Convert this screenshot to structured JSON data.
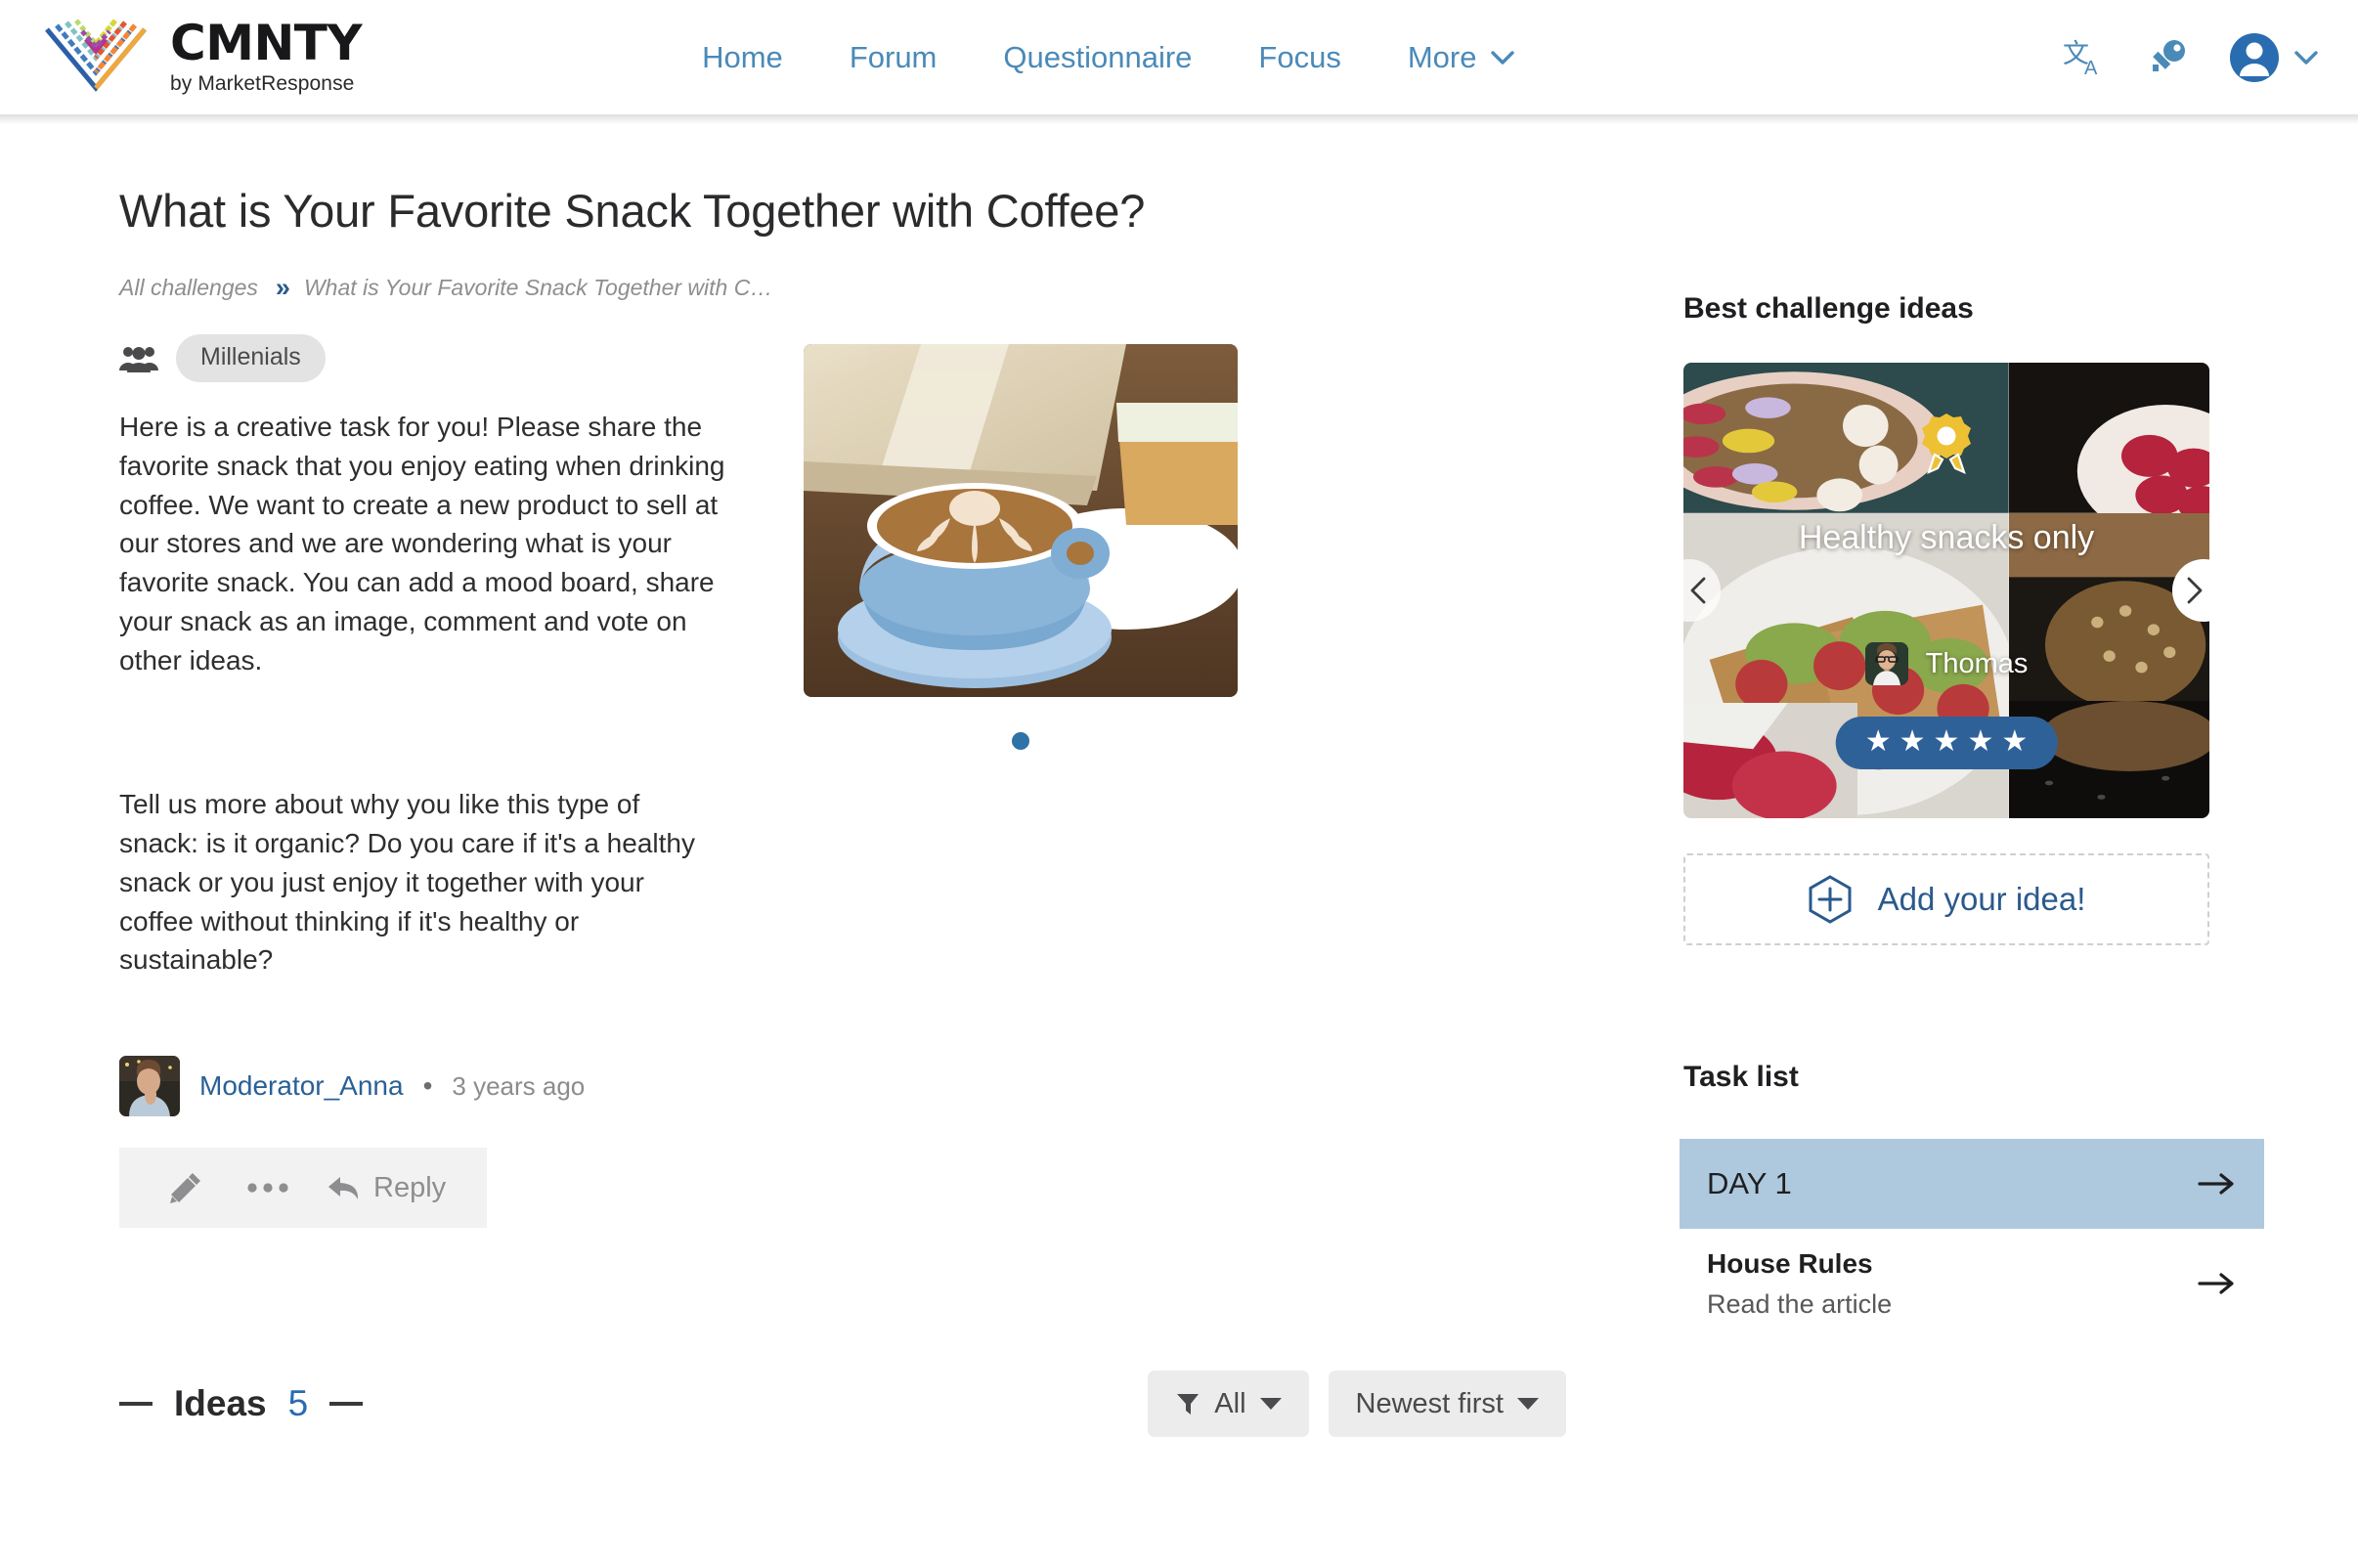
{
  "brand": {
    "name": "CMNTY",
    "tagline": "by MarketResponse",
    "logo_icon": "cmnty-diamond-logo"
  },
  "nav": {
    "items": [
      {
        "label": "Home"
      },
      {
        "label": "Forum"
      },
      {
        "label": "Questionnaire"
      },
      {
        "label": "Focus"
      },
      {
        "label": "More"
      }
    ],
    "more_caret_icon": "chevron-down-icon",
    "icons": [
      {
        "name": "translate-icon",
        "glyph": "文A"
      },
      {
        "name": "key-icon",
        "glyph": "key"
      },
      {
        "name": "user-avatar-icon",
        "glyph": "person"
      }
    ],
    "accent_color": "#4a8ab8"
  },
  "challenge": {
    "title": "What is Your Favorite Snack Together with Coffee?",
    "breadcrumb": {
      "root": "All challenges",
      "separator": "»",
      "current": "What is Your Favorite Snack Together with C…"
    },
    "audience_icon": "users-group-icon",
    "audience_tag": "Millenials",
    "paragraphs": [
      "Here is a creative task for you! Please share the favorite snack that you enjoy eating when drinking coffee. We want to create a new product to sell at our stores and we are wondering what is your favorite snack. You can add a mood board, share your snack as an image, comment and vote on other ideas.",
      "Tell us more about why you like this type of snack: is it organic? Do you care if it's a healthy snack or you just enjoy it together with your coffee without thinking if it's healthy or sustainable?"
    ],
    "hero_image_alt": "blue-coffee-cup-with-latte-art-and-carrot-cake",
    "carousel_dots": 1,
    "dot_color": "#2e72a8"
  },
  "author": {
    "avatar_alt": "moderator-anna-avatar",
    "name": "Moderator_Anna",
    "separator": "•",
    "timestamp": "3 years ago",
    "link_color": "#2a6096"
  },
  "actions": {
    "edit_icon": "pencil-icon",
    "more_icon": "ellipsis-icon",
    "reply_icon": "reply-arrow-icon",
    "reply_label": "Reply"
  },
  "ideas": {
    "label": "Ideas",
    "count": "5",
    "filter_icon": "funnel-icon",
    "filter_label": "All",
    "sort_label": "Newest first"
  },
  "sidebar": {
    "best_ideas_heading": "Best challenge ideas",
    "card": {
      "award_icon": "award-ribbon-icon",
      "title": "Healthy snacks only",
      "author_name": "Thomas",
      "author_avatar_alt": "thomas-avatar",
      "rating_stars": 5,
      "rating_color": "#2f6199",
      "prev_icon": "chevron-left-icon",
      "next_icon": "chevron-right-icon"
    },
    "add_idea": {
      "icon": "hexagon-plus-icon",
      "label": "Add your idea!",
      "color": "#2a5a8c"
    },
    "task_list_heading": "Task list",
    "tasks": [
      {
        "label": "DAY 1",
        "subtitle": "",
        "highlight": true,
        "arrow_icon": "arrow-right-icon"
      },
      {
        "label": "House Rules",
        "subtitle": "Read the article",
        "highlight": false,
        "arrow_icon": "arrow-right-icon"
      }
    ],
    "highlight_color": "#aec9de"
  }
}
